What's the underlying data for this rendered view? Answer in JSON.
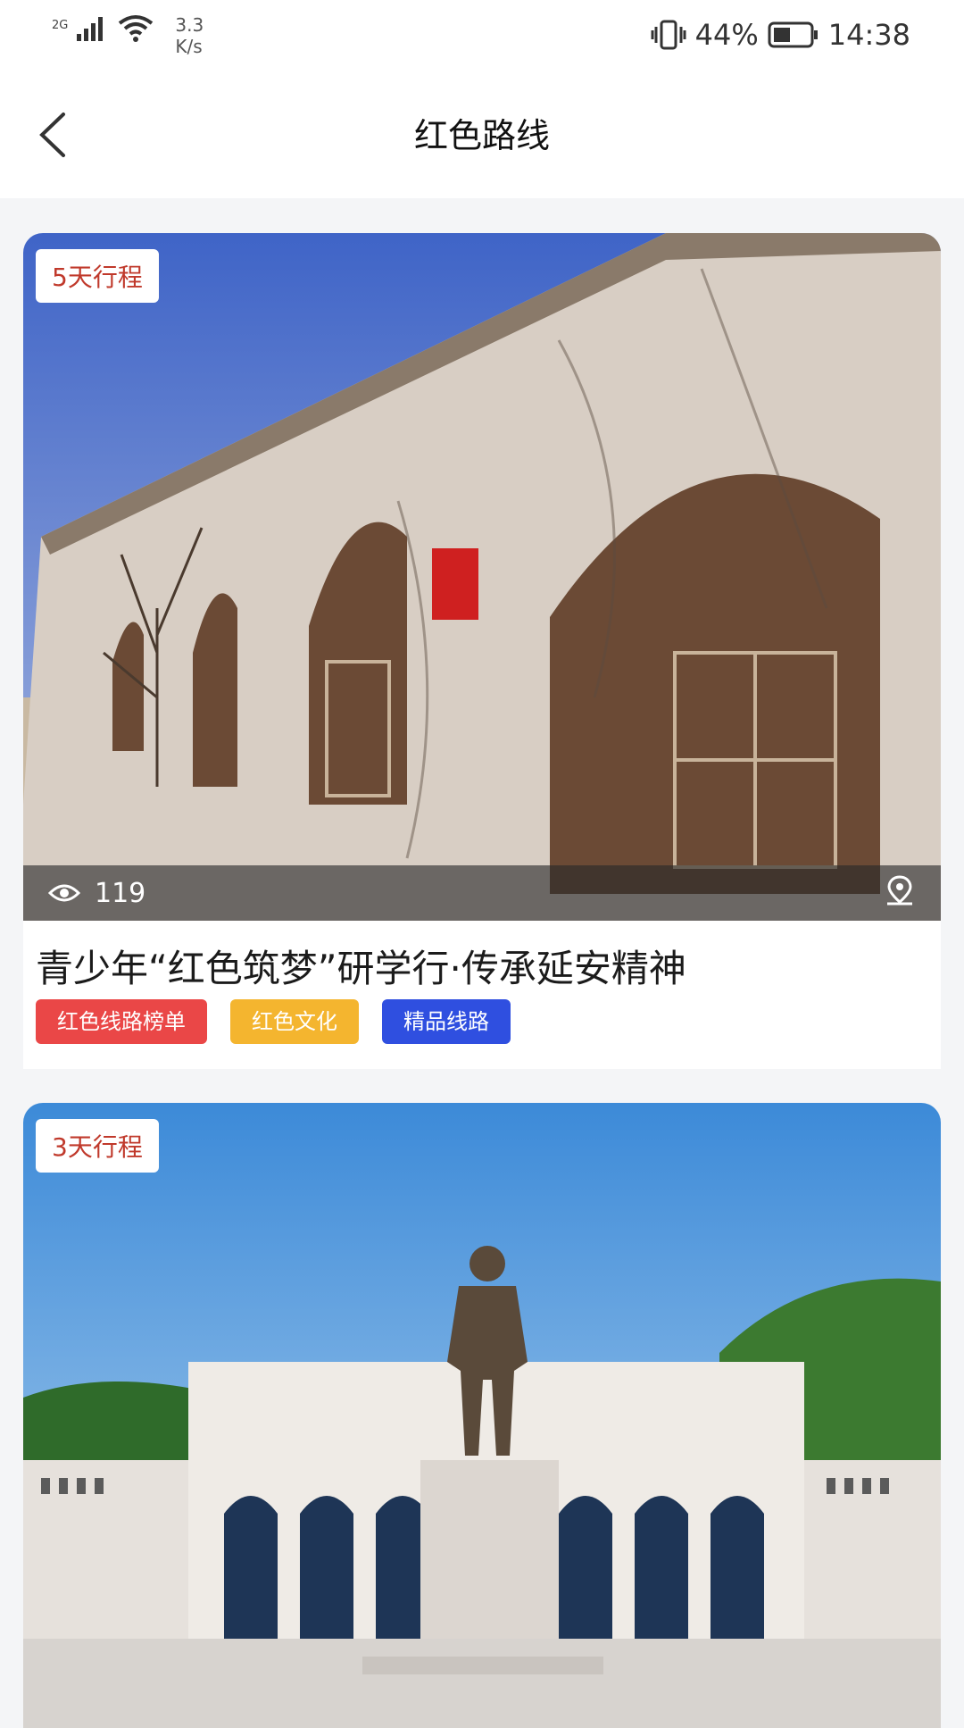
{
  "status_bar": {
    "network": "2G",
    "speed_value": "3.3",
    "speed_unit": "K/s",
    "battery": "44%",
    "time": "14:38"
  },
  "header": {
    "title": "红色路线",
    "back_icon": "chevron-left-icon"
  },
  "routes": [
    {
      "badge": "5天行程",
      "views": "119",
      "title": "青少年“红色筑梦”研学行·传承延安精神",
      "tags": [
        {
          "label": "红色线路榜单",
          "color": "#ea4747"
        },
        {
          "label": "红色文化",
          "color": "#f4b52f"
        },
        {
          "label": "精品线路",
          "color": "#2f4fe0"
        }
      ],
      "icons": [
        "eye-icon",
        "location-pin-icon"
      ]
    },
    {
      "badge": "3天行程"
    }
  ],
  "colors": {
    "badge_text": "#c0392b",
    "background": "#f4f5f7"
  }
}
